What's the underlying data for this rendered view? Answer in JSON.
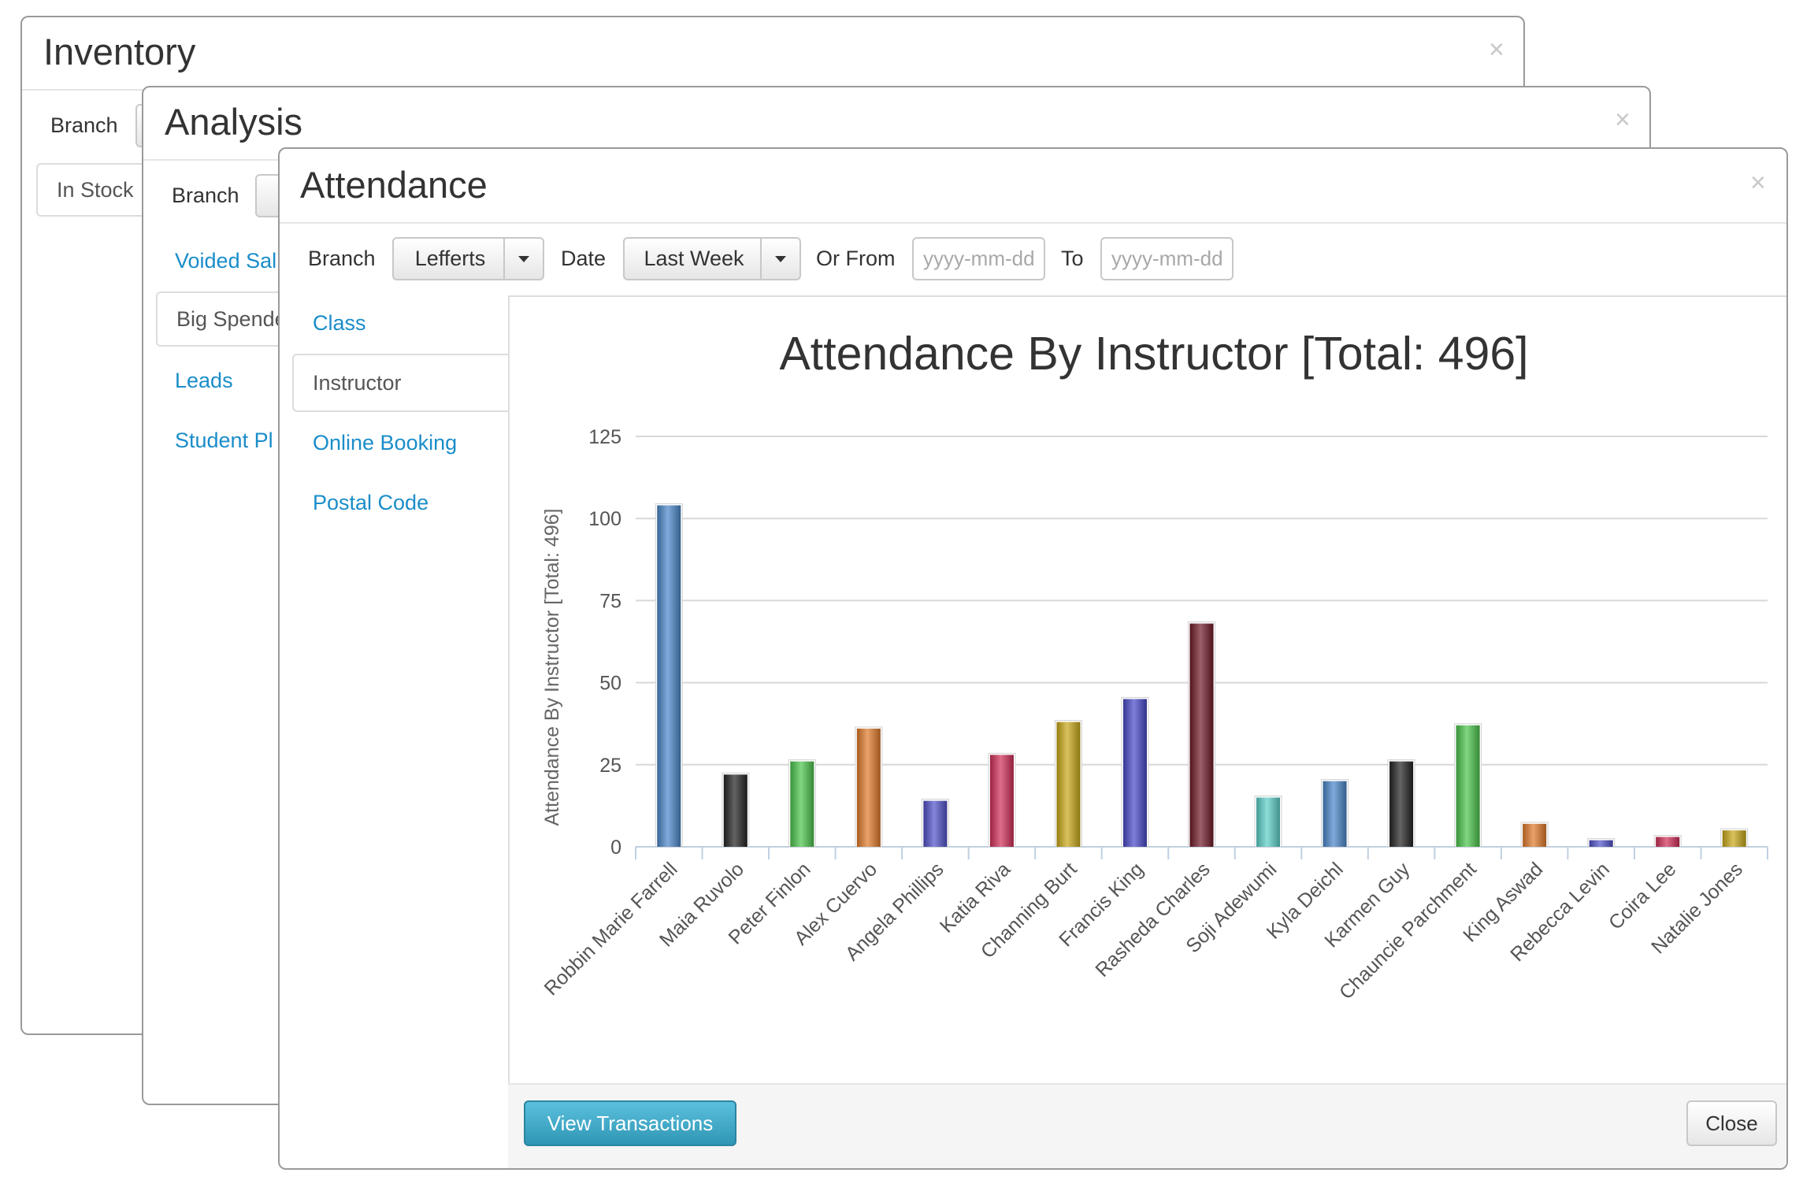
{
  "inventory": {
    "title": "Inventory",
    "close": "×",
    "branch_label": "Branch",
    "tab_in_stock": "In Stock"
  },
  "analysis": {
    "title": "Analysis",
    "close": "×",
    "branch_label": "Branch",
    "links": [
      "Voided Sal",
      "Big Spende",
      "Leads",
      "Student Pl"
    ]
  },
  "attendance": {
    "title": "Attendance",
    "close": "×",
    "filters": {
      "branch_label": "Branch",
      "branch_value": "Lefferts",
      "date_label": "Date",
      "date_value": "Last Week",
      "or_from_label": "Or From",
      "from_placeholder": "yyyy-mm-dd",
      "to_label": "To",
      "to_placeholder": "yyyy-mm-dd"
    },
    "sidebar": {
      "items": [
        "Class",
        "Instructor",
        "Online Booking",
        "Postal Code"
      ],
      "active": "Instructor"
    },
    "footer": {
      "view_transactions": "View Transactions",
      "close": "Close"
    }
  },
  "chart_data": {
    "type": "bar",
    "title": "Attendance By Instructor [Total: 496]",
    "ylabel": "Attendance By Instructor [Total: 496]",
    "xlabel": "",
    "ylim": [
      0,
      125
    ],
    "yticks": [
      "0",
      "25",
      "50",
      "75",
      "100",
      "125"
    ],
    "grid": true,
    "categories": [
      "Robbin Marie Farrell",
      "Maia Ruvolo",
      "Peter Finlon",
      "Alex Cuervo",
      "Angela Phillips",
      "Katia Riva",
      "Channing Burt",
      "Francis King",
      "Rasheda Charles",
      "Soji Adewumi",
      "Kyla Deichl",
      "Karmen Guy",
      "Chauncie Parchment",
      "King Aswad",
      "Rebecca Levin",
      "Coira Lee",
      "Natalie Jones"
    ],
    "values": [
      104,
      22,
      26,
      36,
      14,
      28,
      38,
      45,
      68,
      15,
      20,
      26,
      37,
      7,
      2,
      3,
      5
    ],
    "colors": [
      "#4a86c8",
      "#222222",
      "#4bc44b",
      "#e07b2a",
      "#5050c8",
      "#d02e58",
      "#c8a818",
      "#4848c8",
      "#701a28",
      "#5ccfc8",
      "#4a86c8",
      "#222222",
      "#4bc44b",
      "#e07b2a",
      "#5050c8",
      "#d02e58",
      "#c8a818"
    ]
  }
}
